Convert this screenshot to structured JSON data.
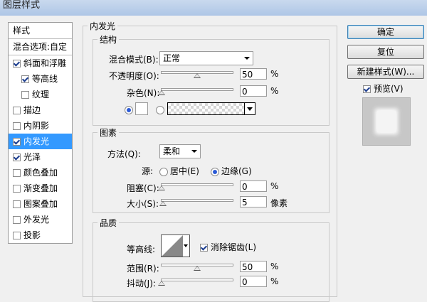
{
  "window": {
    "title": "图层样式"
  },
  "style_list": {
    "header": "样式",
    "blend_options": "混合选项:自定",
    "items": [
      {
        "label": "斜面和浮雕",
        "checked": true,
        "sub": false,
        "selected": false
      },
      {
        "label": "等高线",
        "checked": true,
        "sub": true,
        "selected": false
      },
      {
        "label": "纹理",
        "checked": false,
        "sub": true,
        "selected": false
      },
      {
        "label": "描边",
        "checked": false,
        "sub": false,
        "selected": false
      },
      {
        "label": "内阴影",
        "checked": false,
        "sub": false,
        "selected": false
      },
      {
        "label": "内发光",
        "checked": true,
        "sub": false,
        "selected": true
      },
      {
        "label": "光泽",
        "checked": true,
        "sub": false,
        "selected": false
      },
      {
        "label": "颜色叠加",
        "checked": false,
        "sub": false,
        "selected": false
      },
      {
        "label": "渐变叠加",
        "checked": false,
        "sub": false,
        "selected": false
      },
      {
        "label": "图案叠加",
        "checked": false,
        "sub": false,
        "selected": false
      },
      {
        "label": "外发光",
        "checked": false,
        "sub": false,
        "selected": false
      },
      {
        "label": "投影",
        "checked": false,
        "sub": false,
        "selected": false
      }
    ]
  },
  "panel": {
    "title": "内发光",
    "structure": {
      "title": "结构",
      "blend_mode_label": "混合模式(B):",
      "blend_mode_value": "正常",
      "opacity_label": "不透明度(O):",
      "opacity_value": "50",
      "noise_label": "杂色(N):",
      "noise_value": "0",
      "percent": "%"
    },
    "elements": {
      "title": "图素",
      "method_label": "方法(Q):",
      "method_value": "柔和",
      "source_label": "源:",
      "source_center": "居中(E)",
      "source_edge": "边缘(G)",
      "choke_label": "阻塞(C):",
      "choke_value": "0",
      "size_label": "大小(S):",
      "size_value": "5",
      "percent": "%",
      "px_unit": "像素"
    },
    "quality": {
      "title": "品质",
      "contour_label": "等高线:",
      "antialias_label": "消除锯齿(L)",
      "antialias_checked": true,
      "range_label": "范围(R):",
      "range_value": "50",
      "jitter_label": "抖动(J):",
      "jitter_value": "0",
      "percent": "%"
    }
  },
  "buttons": {
    "ok": "确定",
    "reset": "复位",
    "new_style": "新建样式(W)...",
    "preview_label": "预览(V)",
    "preview_checked": true
  },
  "colors": {
    "selection": "#3399ff",
    "panel_bg": "#f0f0f0"
  }
}
